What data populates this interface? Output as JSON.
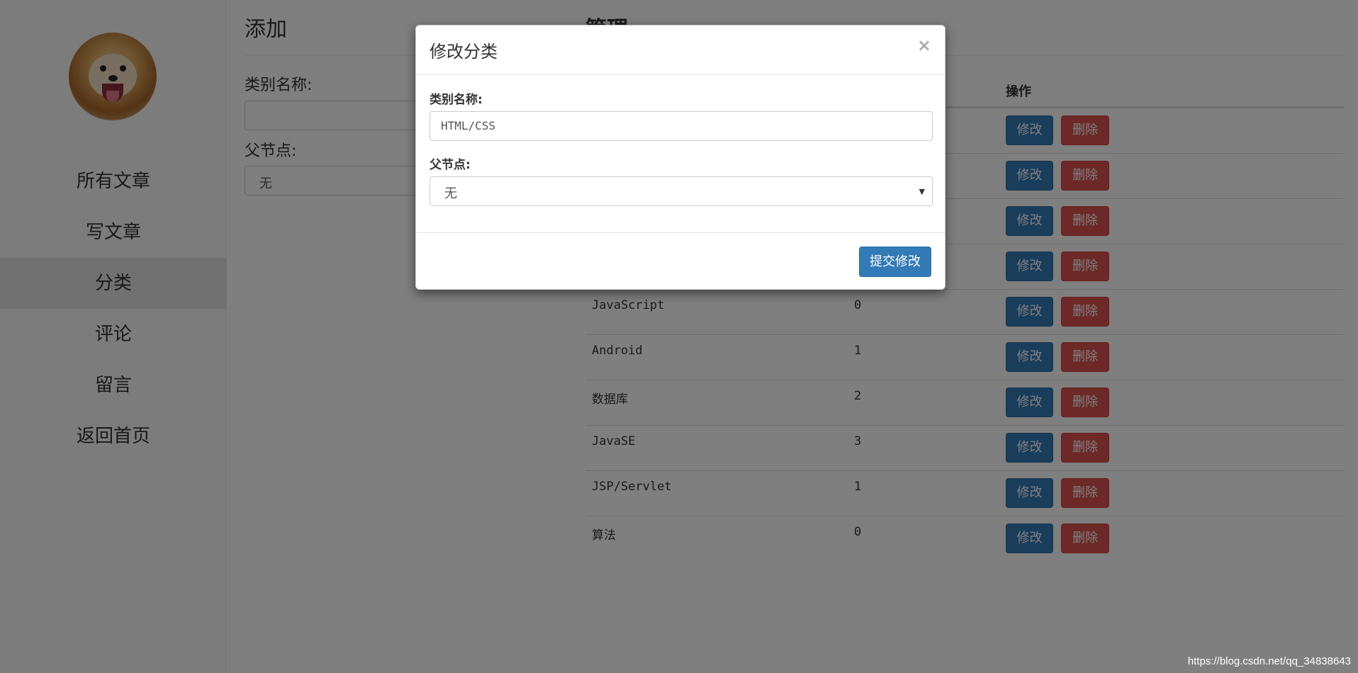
{
  "sidebar": {
    "avatar_alt": "",
    "nav": [
      {
        "label": "所有文章",
        "active": false
      },
      {
        "label": "写文章",
        "active": false
      },
      {
        "label": "分类",
        "active": true
      },
      {
        "label": "评论",
        "active": false
      },
      {
        "label": "留言",
        "active": false
      },
      {
        "label": "返回首页",
        "active": false
      }
    ]
  },
  "add_form": {
    "title": "添加",
    "name_label": "类别名称:",
    "name_value": "",
    "parent_label": "父节点:",
    "parent_value": "无"
  },
  "manage": {
    "title": "管理",
    "headers": {
      "action": "操作"
    },
    "rows": [
      {
        "name": "",
        "count": ""
      },
      {
        "name": "",
        "count": ""
      },
      {
        "name": "",
        "count": ""
      },
      {
        "name": "",
        "count": ""
      },
      {
        "name": "JavaScript",
        "count": "0"
      },
      {
        "name": "Android",
        "count": "1"
      },
      {
        "name": "数据库",
        "count": "2"
      },
      {
        "name": "JavaSE",
        "count": "3"
      },
      {
        "name": "JSP/Servlet",
        "count": "1"
      },
      {
        "name": "算法",
        "count": "0"
      }
    ],
    "edit_label": "修改",
    "delete_label": "删除"
  },
  "modal": {
    "title": "修改分类",
    "close_glyph": "×",
    "name_label": "类别名称:",
    "name_value": "HTML/CSS",
    "parent_label": "父节点:",
    "parent_value": "无",
    "submit_label": "提交修改"
  },
  "watermark": "https://blog.csdn.net/qq_34838643"
}
